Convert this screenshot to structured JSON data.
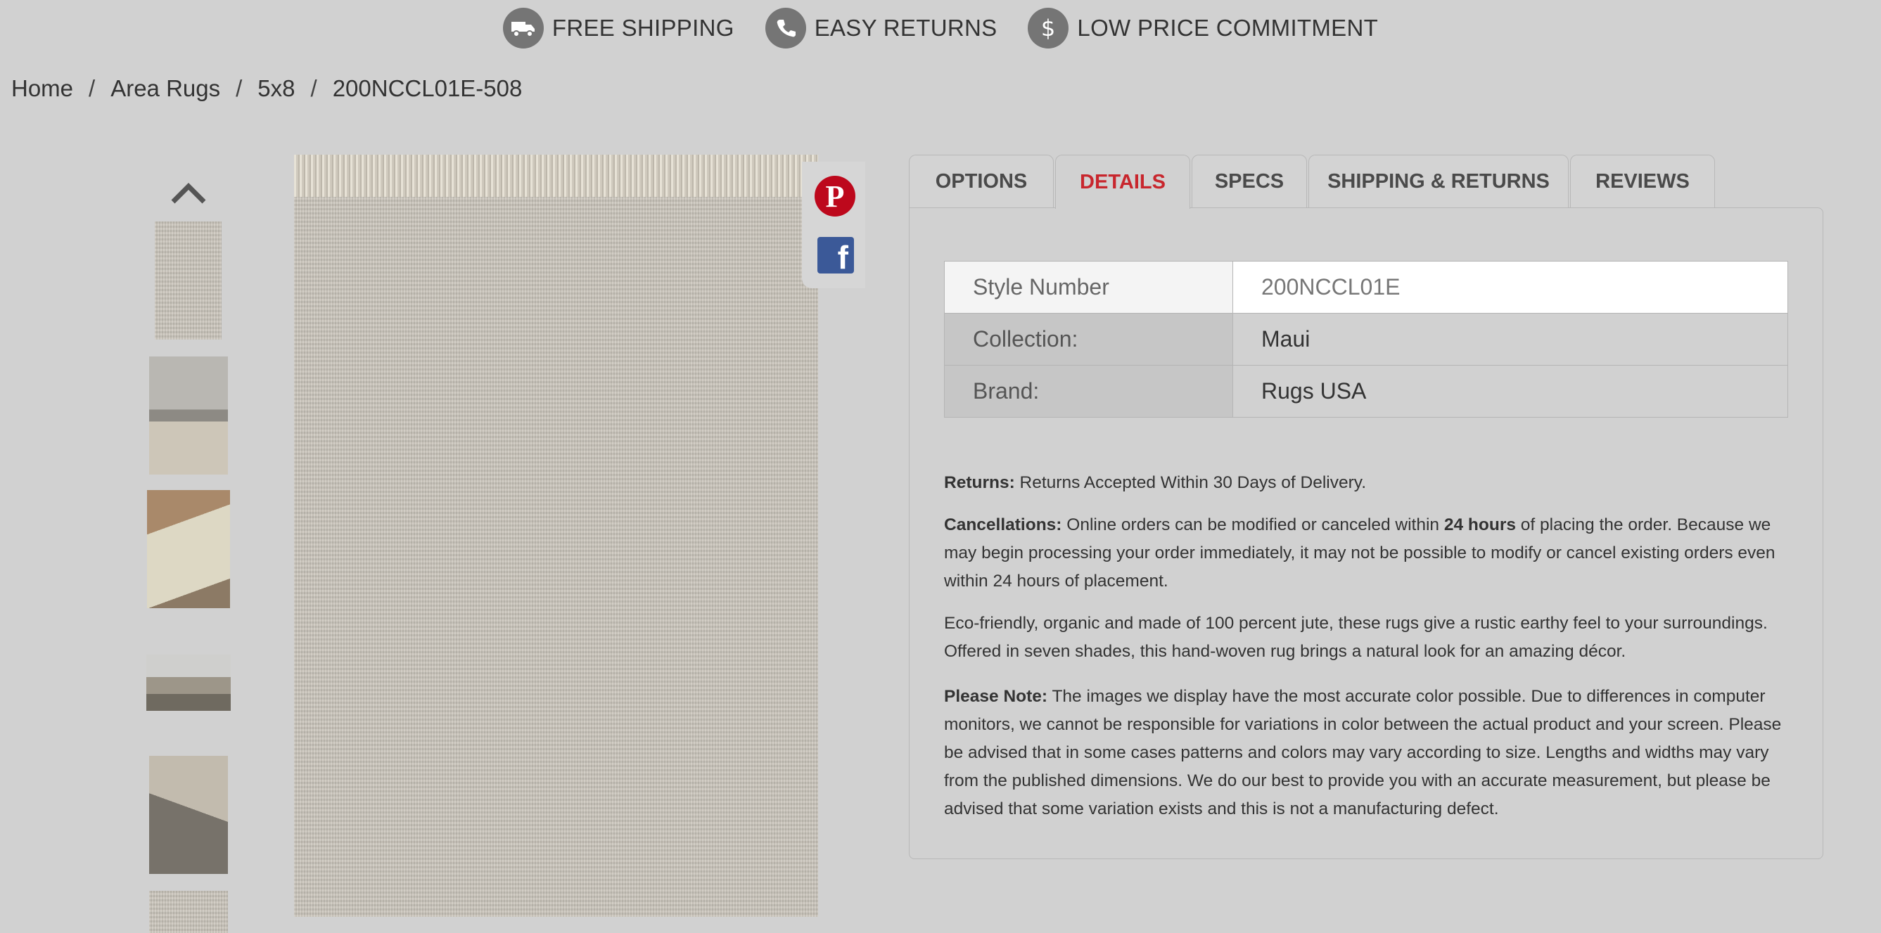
{
  "benefits": [
    {
      "icon": "truck-icon",
      "label": "FREE SHIPPING"
    },
    {
      "icon": "phone-icon",
      "label": "EASY RETURNS"
    },
    {
      "icon": "dollar-icon",
      "label": "LOW PRICE COMMITMENT"
    }
  ],
  "breadcrumb": {
    "items": [
      "Home",
      "Area Rugs",
      "5x8",
      "200NCCL01E-508"
    ],
    "separator": "/"
  },
  "tabs": [
    {
      "label": "OPTIONS",
      "active": false
    },
    {
      "label": "DETAILS",
      "active": true
    },
    {
      "label": "SPECS",
      "active": false
    },
    {
      "label": "SHIPPING & RETURNS",
      "active": false
    },
    {
      "label": "REVIEWS",
      "active": false
    }
  ],
  "details": [
    {
      "key": "Style Number",
      "value": "200NCCL01E"
    },
    {
      "key": "Collection:",
      "value": "Maui"
    },
    {
      "key": "Brand:",
      "value": "Rugs USA"
    }
  ],
  "returns": {
    "label": "Returns:",
    "text": "Returns Accepted Within 30 Days of Delivery."
  },
  "cancellations": {
    "label": "Cancellations:",
    "text_before": "Online orders can be modified or canceled within",
    "bold": "24 hours",
    "text_after": "of placing the order. Because we may begin processing your order immediately, it may not be possible to modify or cancel existing orders even within 24 hours of placement."
  },
  "description": "Eco-friendly, organic and made of 100 percent jute, these rugs give a rustic earthy feel to your surroundings. Offered in seven shades, this hand-woven rug brings a natural look for an amazing décor.",
  "please_note": {
    "label": "Please Note:",
    "text": "The images we display have the most accurate color possible. Due to differences in computer monitors, we cannot be responsible for variations in color between the actual product and your screen. Please be advised that in some cases patterns and colors may vary according to size. Lengths and widths may vary from the published dimensions. We do our best to provide you with an accurate measurement, but please be advised that some variation exists and this is not a manufacturing defect."
  },
  "social": {
    "pinterest_glyph": "P",
    "facebook_glyph": "f"
  },
  "colors": {
    "active_tab": "#c8262d",
    "pinterest": "#bd081c",
    "facebook": "#3b5998"
  }
}
